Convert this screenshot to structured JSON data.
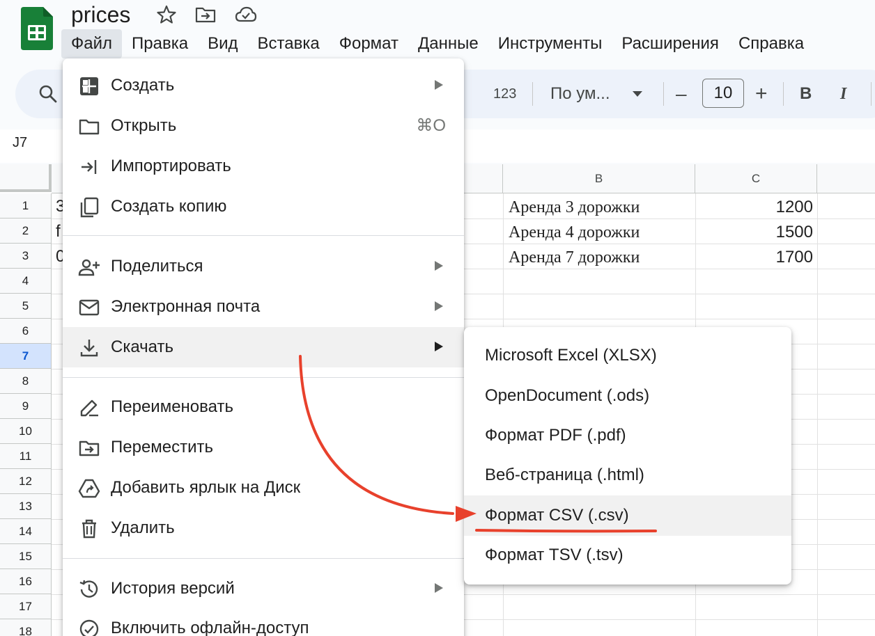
{
  "document": {
    "title": "prices"
  },
  "menubar": {
    "items": [
      "Файл",
      "Правка",
      "Вид",
      "Вставка",
      "Формат",
      "Данные",
      "Инструменты",
      "Расширения",
      "Справка"
    ]
  },
  "toolbar": {
    "format_123": "123",
    "font_name": "По ум...",
    "font_size": "10",
    "minus": "–",
    "plus": "+",
    "bold": "B",
    "italic": "I"
  },
  "formula_bar": {
    "cell_ref": "J7"
  },
  "grid": {
    "columns": [
      "B",
      "C"
    ],
    "rows": [
      "1",
      "2",
      "3",
      "4",
      "5",
      "6",
      "7",
      "8",
      "9",
      "10",
      "11",
      "12",
      "13",
      "14",
      "15",
      "16",
      "17",
      "18"
    ],
    "selected_row": "7",
    "col_a_partial": [
      "3",
      "f",
      "0"
    ],
    "data": [
      {
        "b": "Аренда 3 дорожки",
        "c": "1200"
      },
      {
        "b": "Аренда 4 дорожки",
        "c": "1500"
      },
      {
        "b": "Аренда 7 дорожки",
        "c": "1700"
      }
    ]
  },
  "file_menu": {
    "items": [
      {
        "label": "Создать",
        "icon": "new-icon",
        "submenu": true
      },
      {
        "label": "Открыть",
        "icon": "folder-icon",
        "shortcut": "⌘O"
      },
      {
        "label": "Импортировать",
        "icon": "import-icon"
      },
      {
        "label": "Создать копию",
        "icon": "copy-icon"
      },
      {
        "label": "Поделиться",
        "icon": "share-icon",
        "submenu": true
      },
      {
        "label": "Электронная почта",
        "icon": "email-icon",
        "submenu": true
      },
      {
        "label": "Скачать",
        "icon": "download-icon",
        "submenu": true,
        "active": true
      },
      {
        "label": "Переименовать",
        "icon": "rename-icon"
      },
      {
        "label": "Переместить",
        "icon": "move-icon"
      },
      {
        "label": "Добавить ярлык на Диск",
        "icon": "drive-shortcut-icon"
      },
      {
        "label": "Удалить",
        "icon": "trash-icon"
      },
      {
        "label": "История версий",
        "icon": "history-icon",
        "submenu": true
      },
      {
        "label": "Включить офлайн-доступ",
        "icon": "offline-icon"
      }
    ]
  },
  "download_submenu": {
    "items": [
      "Microsoft Excel (XLSX)",
      "OpenDocument (.ods)",
      "Формат PDF (.pdf)",
      "Веб-страница (.html)",
      "Формат CSV (.csv)",
      "Формат TSV (.tsv)"
    ],
    "highlighted_index": 4
  },
  "colors": {
    "accent": "#188038",
    "annotation": "#e8412c",
    "selection": "#d3e3fd"
  }
}
